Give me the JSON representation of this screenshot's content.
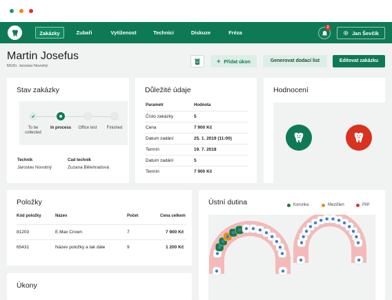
{
  "colors": {
    "brand": "#0e7a55",
    "good": "#0e7a55",
    "bad": "#d9321f",
    "crown": "#1a7a3a",
    "bridge": "#f2890f",
    "pillar": "#e03131",
    "tooth_marker": "#3a7fd0"
  },
  "nav": {
    "items": [
      "Zakázky",
      "Zubaři",
      "Vytíženost",
      "Technici",
      "Diskuze",
      "Fréza"
    ],
    "notifications": "2",
    "user": "Jan Ševčík"
  },
  "header": {
    "patient": "Martin Josefus",
    "doctor": "MUDr. Jaroslav Novotný",
    "add_action": "Přidat úkon",
    "generate_action": "Generovat dodací list",
    "edit_action": "Editovat zakázku"
  },
  "status": {
    "title": "Stav zakázky",
    "steps": [
      {
        "label": "To be collected",
        "state": "done"
      },
      {
        "label": "In process",
        "state": "current"
      },
      {
        "label": "Office test",
        "state": "todo"
      },
      {
        "label": "Finished",
        "state": "todo"
      }
    ],
    "technician_label": "Technik",
    "technician": "Jaroslav Novotný",
    "cad_label": "Cad technik",
    "cad": "Zuzana Bělehradová"
  },
  "details": {
    "title": "Důležité údaje",
    "headers": [
      "Parametr",
      "Hodnota"
    ],
    "rows": [
      [
        "Číslo zakázky",
        "5"
      ],
      [
        "Cena",
        "7 900 Kč"
      ],
      [
        "Datum zadání",
        "25. 1. 2019 (11:00)"
      ],
      [
        "Termín",
        "19. 7. 2018"
      ],
      [
        "Datum zadání",
        "5"
      ],
      [
        "Termín",
        "7 900 Kč"
      ]
    ]
  },
  "rating": {
    "title": "Hodnocení"
  },
  "items": {
    "title": "Položky",
    "headers": [
      "Kód položky",
      "Název",
      "Počet",
      "Cena celkem"
    ],
    "rows": [
      [
        "81203",
        "E.Max Crown",
        "7",
        "7 900 Kč"
      ],
      [
        "65431",
        "Název položky a tak dále",
        "9",
        "1 200 Kč"
      ]
    ]
  },
  "mouth": {
    "title": "Ústní dutina",
    "legend": [
      {
        "label": "Korunka",
        "color": "#1a7a3a"
      },
      {
        "label": "Mezičlen",
        "color": "#f2890f"
      },
      {
        "label": "Pilíř",
        "color": "#e03131"
      }
    ]
  },
  "actions": {
    "title": "Úkony"
  }
}
